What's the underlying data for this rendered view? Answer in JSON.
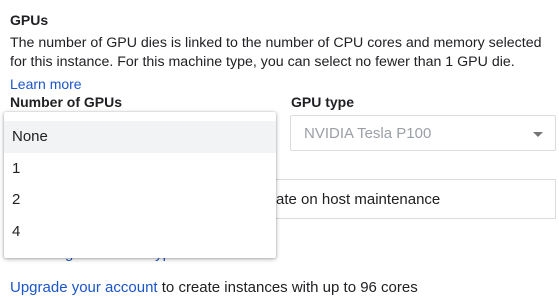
{
  "gpus": {
    "title": "GPUs",
    "description": "The number of GPU dies is linked to the number of CPU cores and memory selected for this instance. For this machine type, you can select no fewer than 1 GPU die.",
    "learn_more": "Learn more",
    "number_label": "Number of GPUs",
    "type_label": "GPU type",
    "type_value": "NVIDIA Tesla P100",
    "number_options": [
      "None",
      "1",
      "2",
      "4"
    ],
    "selected_option": "None"
  },
  "maintenance": {
    "visible_text": "rate on host maintenance"
  },
  "machine_type_link": {
    "visible_text": "Choosing a machine type"
  },
  "upgrade": {
    "link": "Upgrade your account",
    "rest": " to create instances with up to 96 cores"
  },
  "colors": {
    "link": "#1a56c8",
    "text": "#202124",
    "disabled_text": "#9aa0a6",
    "border": "#dadce0",
    "selected_bg": "#f1f3f4"
  }
}
